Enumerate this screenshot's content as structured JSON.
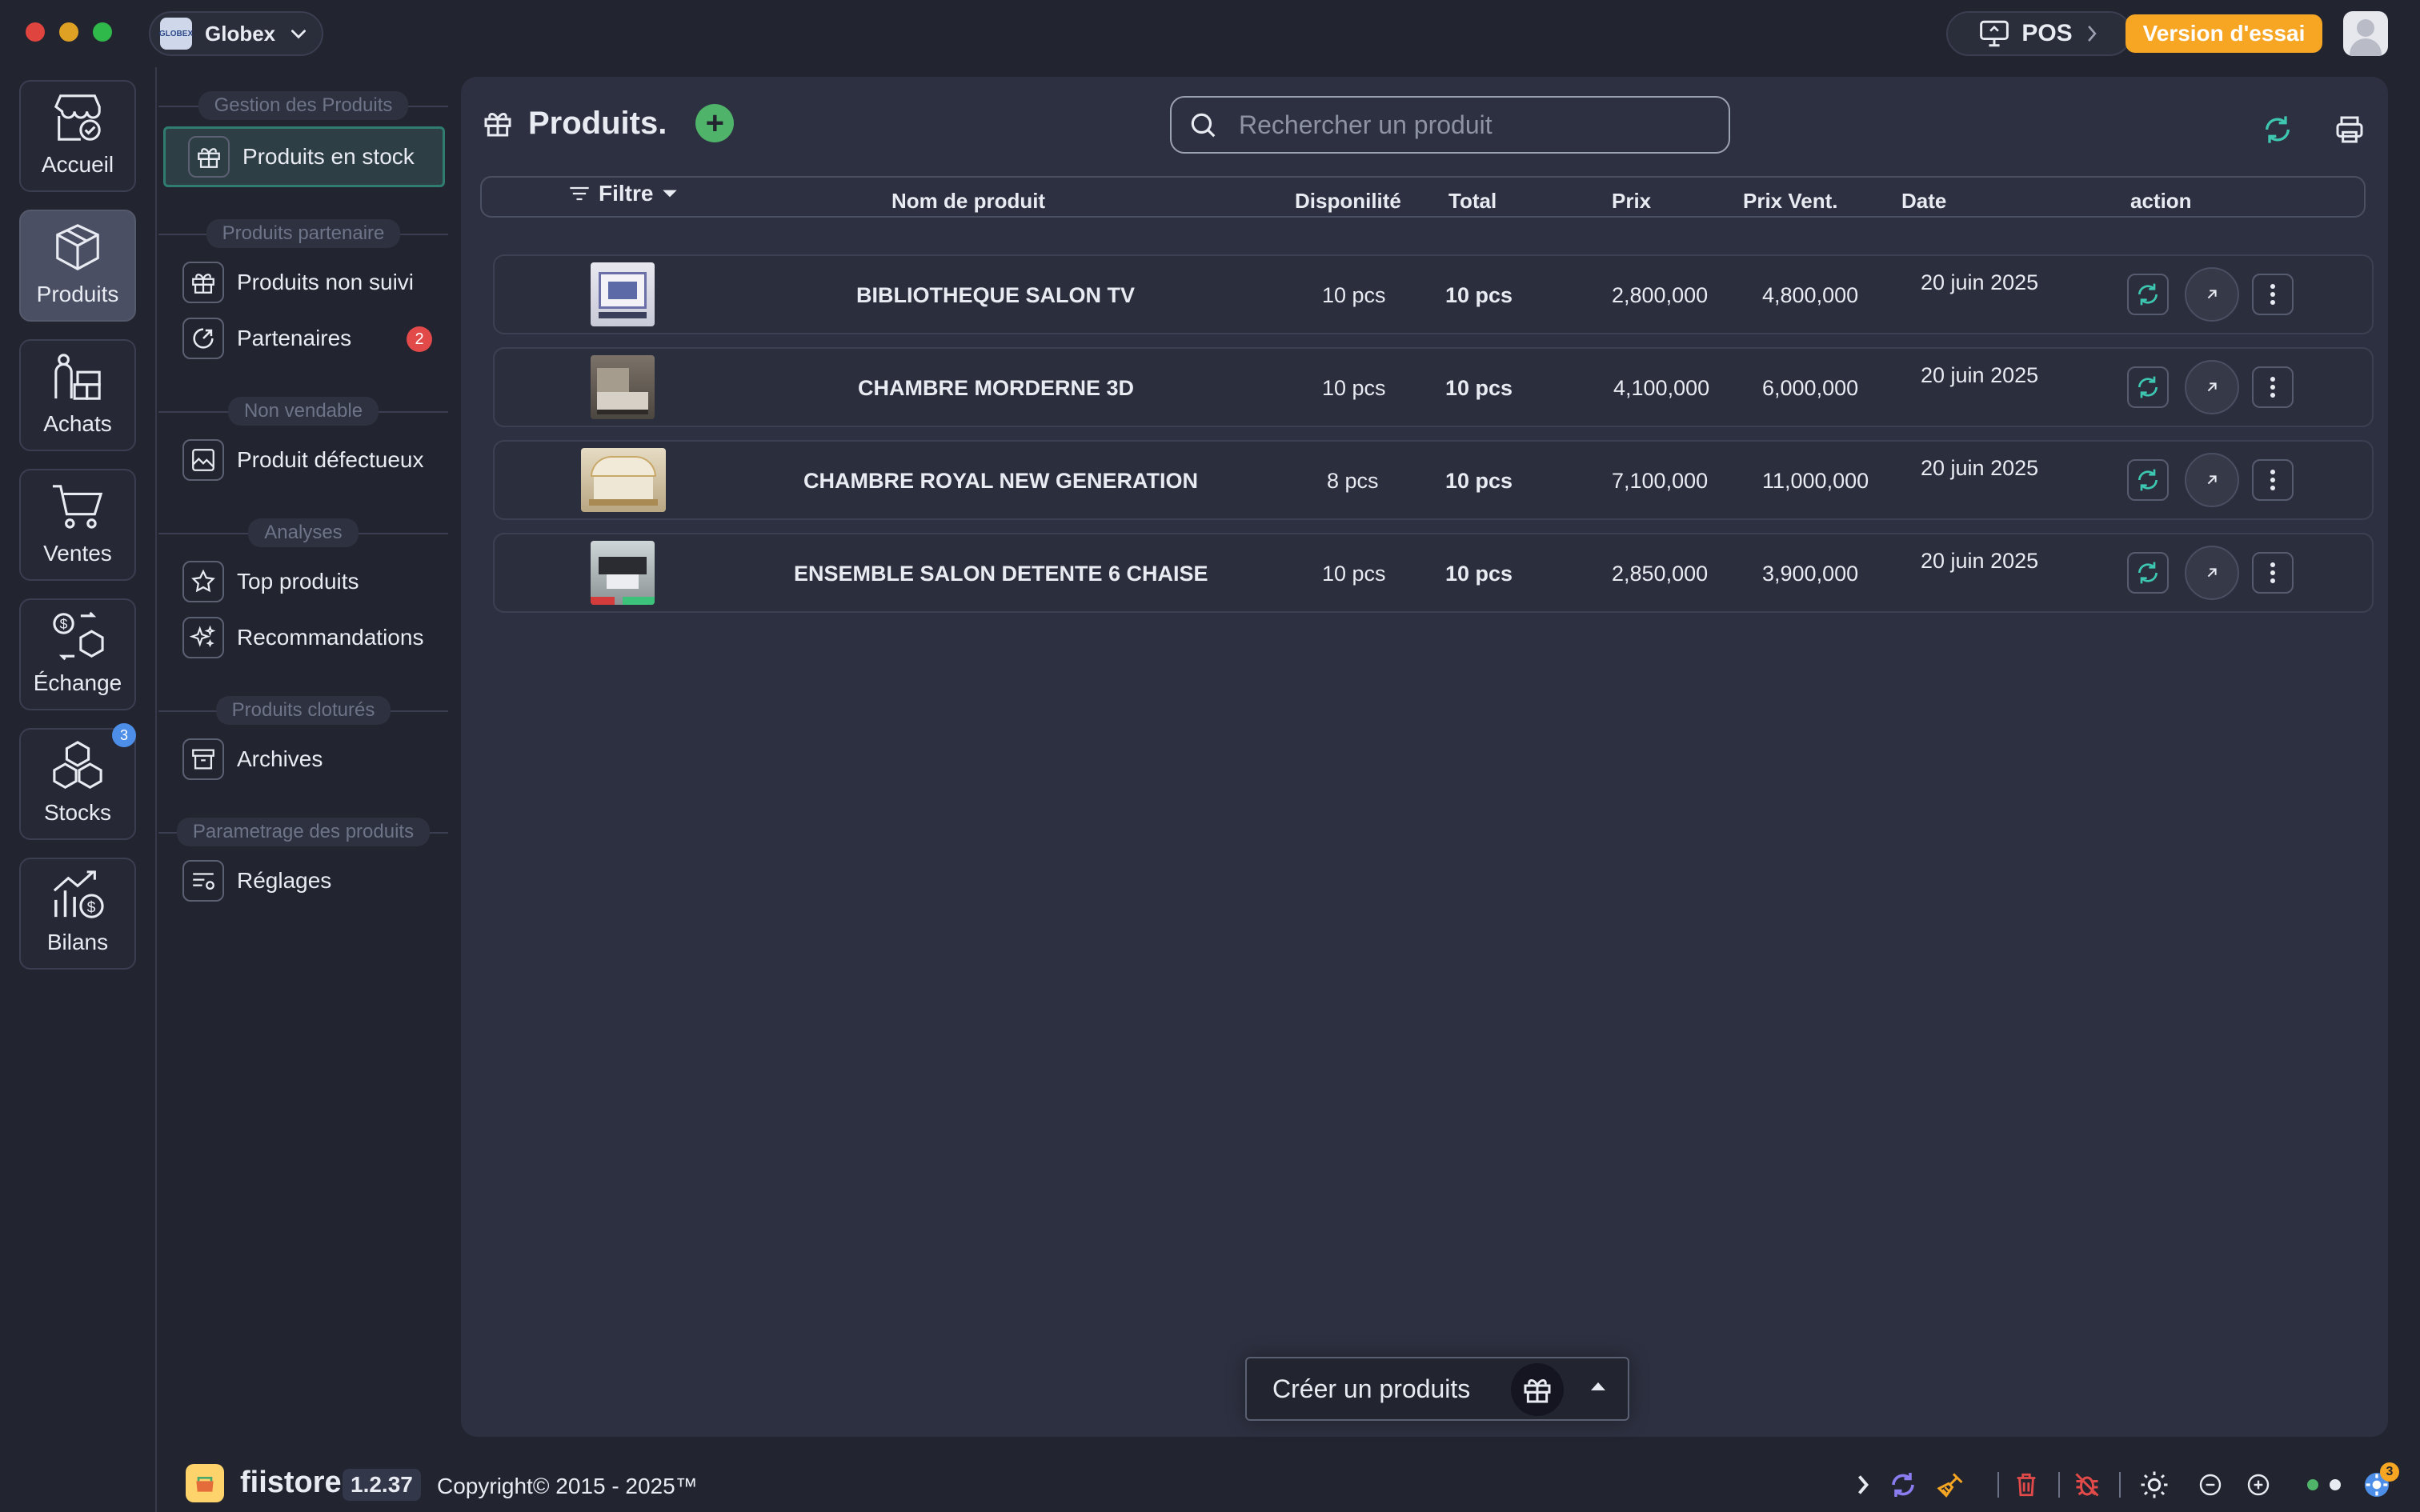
{
  "org": {
    "logo_text": "GLOBEX",
    "name": "Globex"
  },
  "topbar": {
    "pos_label": "POS",
    "trial_label": "Version d'essai"
  },
  "rail": [
    {
      "label": "Accueil",
      "icon": "shop-icon"
    },
    {
      "label": "Produits",
      "icon": "box-icon"
    },
    {
      "label": "Achats",
      "icon": "purchase-icon"
    },
    {
      "label": "Ventes",
      "icon": "cart-icon"
    },
    {
      "label": "Échange",
      "icon": "exchange-icon"
    },
    {
      "label": "Stocks",
      "icon": "stock-icon",
      "badge": "3"
    },
    {
      "label": "Bilans",
      "icon": "report-icon"
    }
  ],
  "subnav": {
    "sections": [
      "Gestion des Produits",
      "Produits partenaire",
      "Non vendable",
      "Analyses",
      "Produits cloturés",
      "Parametrage des produits"
    ],
    "items": [
      {
        "label": "Produits en stock",
        "icon": "gift-icon"
      },
      {
        "label": "Produits non suivi",
        "icon": "gift-icon"
      },
      {
        "label": "Partenaires",
        "icon": "partner-icon",
        "badge": "2"
      },
      {
        "label": "Produit défectueux",
        "icon": "broken-image-icon"
      },
      {
        "label": "Top produits",
        "icon": "star-icon"
      },
      {
        "label": "Recommandations",
        "icon": "sparkle-icon"
      },
      {
        "label": "Archives",
        "icon": "archive-icon"
      },
      {
        "label": "Réglages",
        "icon": "settings-list-icon"
      }
    ]
  },
  "main": {
    "title": "Produits.",
    "search_placeholder": "Rechercher un produit",
    "filter_label": "Filtre",
    "columns": [
      "Nom de produit",
      "Disponilité",
      "Total",
      "Prix",
      "Prix Vent.",
      "Date",
      "action"
    ],
    "rows": [
      {
        "name": "BIBLIOTHEQUE SALON TV",
        "dispo": "10 pcs",
        "total": "10 pcs",
        "prix": "2,800,000",
        "prix_vente": "4,800,000",
        "date": "20 juin 2025"
      },
      {
        "name": "CHAMBRE MORDERNE 3D",
        "dispo": "10 pcs",
        "total": "10 pcs",
        "prix": "4,100,000",
        "prix_vente": "6,000,000",
        "date": "20 juin 2025"
      },
      {
        "name": "CHAMBRE ROYAL NEW GENERATION",
        "dispo": "8 pcs",
        "total": "10 pcs",
        "prix": "7,100,000",
        "prix_vente": "11,000,000",
        "date": "20 juin 2025"
      },
      {
        "name": "ENSEMBLE SALON DETENTE 6 CHAISE",
        "dispo": "10 pcs",
        "total": "10 pcs",
        "prix": "2,850,000",
        "prix_vente": "3,900,000",
        "date": "20 juin 2025"
      }
    ],
    "create_label": "Créer un produits"
  },
  "footer": {
    "brand": "fiistore",
    "version": "1.2.37",
    "copyright": "Copyright© 2015 - 2025™",
    "badge": "3"
  },
  "colors": {
    "accent": "#f6a623",
    "teal": "#3ec7b0",
    "danger": "#e24a4a",
    "blue": "#4d8fe8"
  }
}
